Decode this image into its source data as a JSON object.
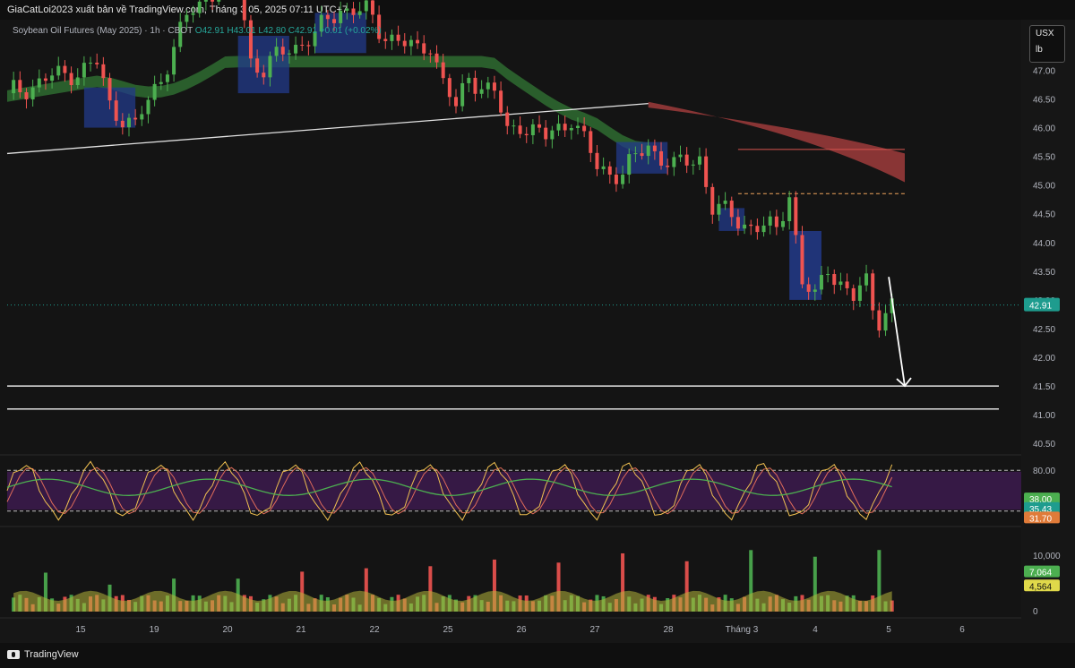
{
  "header": {
    "publisher": "GiaCatLoi2023 xuất bản về TradingView.com, Tháng 3 05, 2025 07:11 UTC+7"
  },
  "legend": {
    "symbol": "Soybean Oil Futures (May 2025) · 1h · CBOT",
    "open": "O42.91",
    "high": "H43.01",
    "low": "L42.80",
    "close": "C42.91",
    "change": "+0.01 (+0.02%)"
  },
  "unit_box": {
    "currency": "USX",
    "unit": "lb"
  },
  "footer": {
    "brand": "TradingView"
  },
  "colors": {
    "up": "#4caf50",
    "down": "#ef5350",
    "ribbon_green": "#2e6b30",
    "ribbon_red": "#9e3b3b",
    "demand_box": "#223a8a",
    "last_price": "#1e9c8e",
    "background": "#161616"
  },
  "chart_data": [
    {
      "type": "candlestick",
      "name": "price",
      "price_axis_ticks": [
        "47.00",
        "46.50",
        "46.00",
        "45.50",
        "45.00",
        "44.50",
        "44.00",
        "43.50",
        "43.00",
        "42.50",
        "42.00",
        "41.50",
        "41.00",
        "40.50"
      ],
      "ylim": [
        40.3,
        47.6
      ],
      "last_price_label": "42.91",
      "close_path": [
        [
          0,
          46.6
        ],
        [
          8,
          46.9
        ],
        [
          14,
          47.1
        ],
        [
          16,
          46.4
        ],
        [
          20,
          46.0
        ],
        [
          24,
          46.9
        ],
        [
          28,
          47.9
        ],
        [
          32,
          48.4
        ],
        [
          36,
          48.6
        ],
        [
          38,
          47.2
        ],
        [
          40,
          47.0
        ],
        [
          44,
          47.4
        ],
        [
          48,
          47.6
        ],
        [
          52,
          48.1
        ],
        [
          56,
          48.0
        ],
        [
          58,
          47.7
        ],
        [
          60,
          47.6
        ],
        [
          64,
          47.3
        ],
        [
          66,
          47.5
        ],
        [
          68,
          46.8
        ],
        [
          70,
          46.3
        ],
        [
          72,
          46.9
        ],
        [
          76,
          46.6
        ],
        [
          78,
          45.9
        ],
        [
          80,
          46.1
        ],
        [
          84,
          45.8
        ],
        [
          88,
          46.2
        ],
        [
          92,
          45.3
        ],
        [
          96,
          45.2
        ],
        [
          100,
          45.7
        ],
        [
          104,
          45.3
        ],
        [
          108,
          45.5
        ],
        [
          110,
          44.6
        ],
        [
          112,
          44.5
        ],
        [
          116,
          44.3
        ],
        [
          120,
          44.2
        ],
        [
          122,
          44.9
        ],
        [
          124,
          43.3
        ],
        [
          126,
          43.0
        ],
        [
          128,
          43.6
        ],
        [
          132,
          43.0
        ],
        [
          134,
          43.3
        ],
        [
          135,
          42.9
        ],
        [
          136,
          42.7
        ],
        [
          138,
          42.91
        ]
      ],
      "volume_axis_ticks": [
        "10,000",
        "0"
      ],
      "volume_labels": {
        "last": "7,064",
        "ma": "4,564"
      },
      "oscillator_axis_ticks": [
        "80.00"
      ],
      "oscillator_labels": {
        "k": "38.00",
        "d": "35.43",
        "other": "31.70"
      },
      "projection": {
        "from": 43.4,
        "to": 41.5
      },
      "horizontal_levels": [
        41.5,
        41.1
      ],
      "x_ticks": [
        "15",
        "19",
        "20",
        "21",
        "22",
        "25",
        "26",
        "27",
        "28",
        "Tháng 3",
        "4",
        "5",
        "6"
      ]
    }
  ]
}
